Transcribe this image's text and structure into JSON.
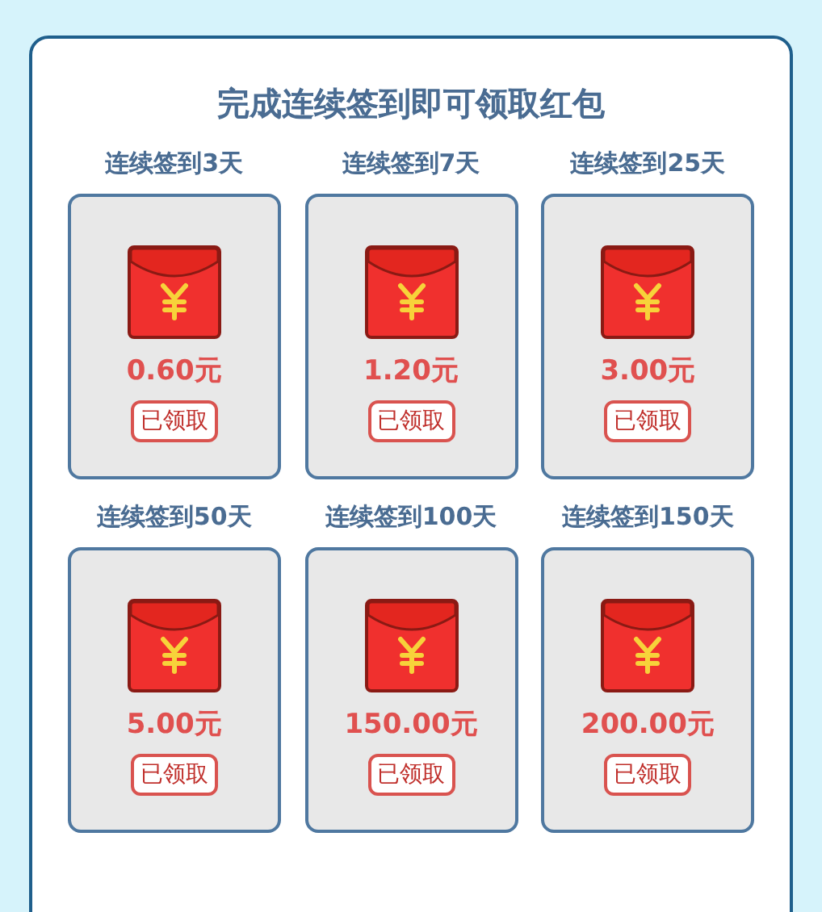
{
  "title": "完成连续签到即可领取红包",
  "rewards": [
    {
      "label": "连续签到3天",
      "amount": "0.60元",
      "button": "已领取",
      "claimed": true
    },
    {
      "label": "连续签到7天",
      "amount": "1.20元",
      "button": "已领取",
      "claimed": true
    },
    {
      "label": "连续签到25天",
      "amount": "3.00元",
      "button": "已领取",
      "claimed": true
    },
    {
      "label": "连续签到50天",
      "amount": "5.00元",
      "button": "已领取",
      "claimed": true
    },
    {
      "label": "连续签到100天",
      "amount": "150.00元",
      "button": "已领取",
      "claimed": true
    },
    {
      "label": "连续签到150天",
      "amount": "200.00元",
      "button": "已领取",
      "claimed": true
    }
  ]
}
